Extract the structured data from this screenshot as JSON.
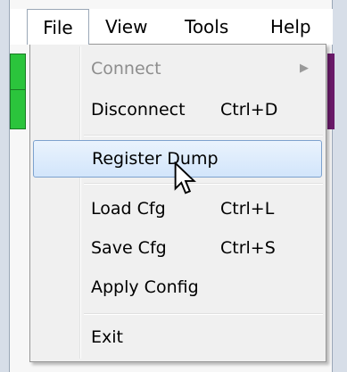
{
  "menubar": {
    "file": "File",
    "view": "View",
    "tools": "Tools",
    "help": "Help"
  },
  "file_menu": {
    "connect": "Connect",
    "disconnect": "Disconnect",
    "disconnect_shortcut": "Ctrl+D",
    "register_dump": "Register Dump",
    "load_cfg": "Load Cfg",
    "load_cfg_shortcut": "Ctrl+L",
    "save_cfg": "Save Cfg",
    "save_cfg_shortcut": "Ctrl+S",
    "apply_config": "Apply Config",
    "exit": "Exit",
    "submenu_arrow": "▶"
  },
  "colors": {
    "highlight_border": "#7da2ce",
    "menu_background": "#f0f0f0",
    "disabled_text": "#8d8d8d"
  },
  "icons": {
    "cursor": "arrow-cursor-icon",
    "submenu": "chevron-right-icon"
  }
}
